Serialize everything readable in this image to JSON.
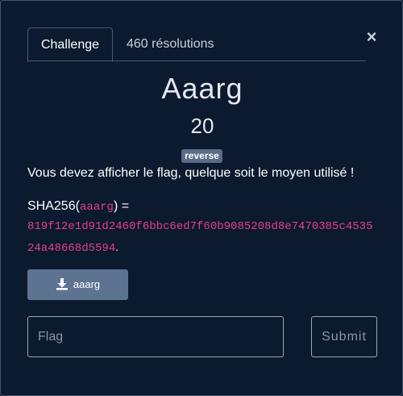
{
  "tabs": [
    {
      "label": "Challenge",
      "active": true
    },
    {
      "label": "460 résolutions",
      "active": false
    }
  ],
  "close_label": "×",
  "challenge": {
    "name": "Aaarg",
    "points": "20",
    "tag": "reverse",
    "description": "Vous devez afficher le flag, quelque soit le moyen utilisé !",
    "sha_prefix": "SHA256(",
    "sha_filename": "aaarg",
    "sha_suffix": ") =",
    "hash_line1": "819f12e1d91d2460f6bbc6ed7f60b9085208d8e7470385c4535",
    "hash_line2": "24a48668d5594",
    "hash_end": "."
  },
  "download": {
    "label": "aaarg",
    "icon": "download-icon"
  },
  "form": {
    "flag_placeholder": "Flag",
    "submit_label": "Submit"
  },
  "colors": {
    "background": "#0b1a2e",
    "accent_pink": "#e83e8c",
    "button": "#5e7391",
    "tag": "#5a6b85"
  }
}
